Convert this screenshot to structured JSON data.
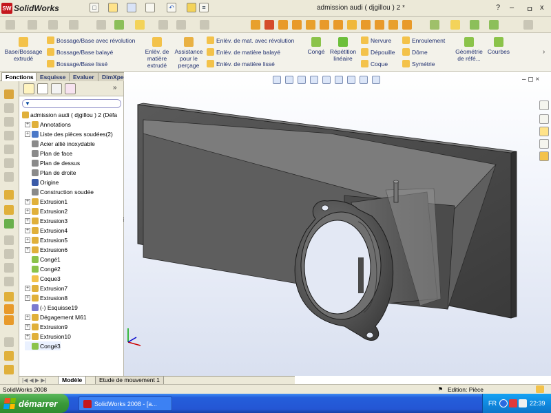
{
  "app": {
    "name": "SolidWorks",
    "document_title": "admission audi  ( djgillou ) 2 *"
  },
  "titlebar": {
    "help_label": "?",
    "minimize_label": "–",
    "restore_label": "ㅁ",
    "close_label": "x"
  },
  "ribbon": {
    "base_extrude": "Base/Bossage extrudé",
    "revolve": "Bossage/Base avec révolution",
    "sweep": "Bossage/Base balayé",
    "loft": "Bossage/Base lissé",
    "cut_extrude": "Enlèv. de matière extrudé",
    "hole_wizard": "Assistance pour le perçage",
    "cut_revolve": "Enlèv. de mat. avec révolution",
    "cut_sweep": "Enlèv. de matière balayé",
    "cut_loft": "Enlèv. de matière lissé",
    "fillet": "Congé",
    "linear_pattern": "Répétition linéaire",
    "rib": "Nervure",
    "draft": "Dépouille",
    "shell": "Coque",
    "wrap": "Enroulement",
    "dome": "Dôme",
    "mirror": "Symétrie",
    "ref_geometry": "Géométrie de réfé...",
    "curves": "Courbes"
  },
  "tabs": [
    "Fonctions",
    "Esquisse",
    "Evaluer",
    "DimXpert"
  ],
  "tree": {
    "root": "admission audi  ( djgillou ) 2  (Défa",
    "items": [
      {
        "label": "Annotations",
        "expand": true
      },
      {
        "label": "Liste des pièces soudées(2)",
        "expand": true
      },
      {
        "label": "Acier allié inoxydable",
        "expand": false
      },
      {
        "label": "Plan de face",
        "expand": false
      },
      {
        "label": "Plan de dessus",
        "expand": false
      },
      {
        "label": "Plan de droite",
        "expand": false
      },
      {
        "label": "Origine",
        "expand": false
      },
      {
        "label": "Construction soudée",
        "expand": false
      },
      {
        "label": "Extrusion1",
        "expand": true
      },
      {
        "label": "Extrusion2",
        "expand": true
      },
      {
        "label": "Extrusion3",
        "expand": true
      },
      {
        "label": "Extrusion4",
        "expand": true
      },
      {
        "label": "Extrusion5",
        "expand": true
      },
      {
        "label": "Extrusion6",
        "expand": true
      },
      {
        "label": "Congé1",
        "expand": false
      },
      {
        "label": "Congé2",
        "expand": false
      },
      {
        "label": "Coque3",
        "expand": false
      },
      {
        "label": "Extrusion7",
        "expand": true
      },
      {
        "label": "Extrusion8",
        "expand": true
      },
      {
        "label": "(-) Esquisse19",
        "expand": false
      },
      {
        "label": "Dégagement M61",
        "expand": true
      },
      {
        "label": "Extrusion9",
        "expand": true
      },
      {
        "label": "Extrusion10",
        "expand": true
      },
      {
        "label": "Congé3",
        "expand": false
      }
    ],
    "selected_index": 23
  },
  "bottom_tabs": [
    "Modèle",
    "Etude de mouvement 1"
  ],
  "status": {
    "left": "SolidWorks 2008",
    "right": "Edition: Pièce"
  },
  "taskbar": {
    "start_label": "démarrer",
    "task_label": "SolidWorks 2008 - [a...",
    "lang": "FR",
    "clock": "22:39"
  },
  "colors": {
    "accent": "#1f2f6f",
    "viewport_bg": "#e6ebf6",
    "part_color": "#4f4f4f"
  }
}
